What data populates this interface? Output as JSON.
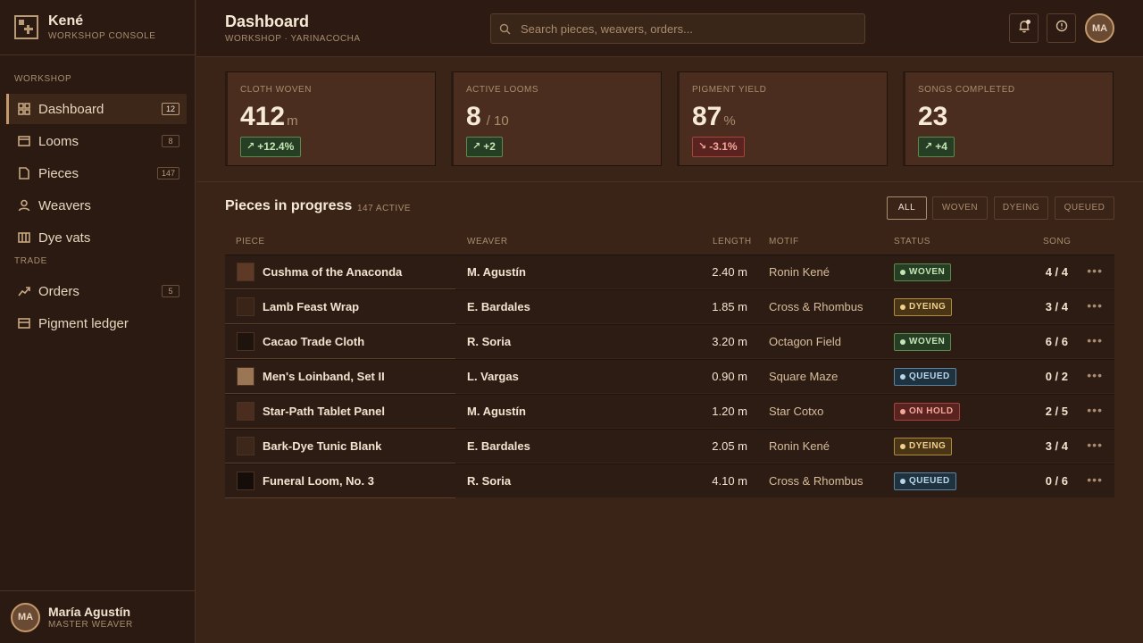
{
  "brand": {
    "title": "Kené",
    "subtitle": "WORKSHOP CONSOLE"
  },
  "sidebar": {
    "sections": [
      {
        "label": "WORKSHOP"
      },
      {
        "label": "TRADE"
      }
    ],
    "items": [
      {
        "label": "Dashboard",
        "count": "12",
        "icon": "grid-icon",
        "active": true
      },
      {
        "label": "Looms",
        "count": "8",
        "icon": "loom-icon"
      },
      {
        "label": "Pieces",
        "count": "147",
        "icon": "document-icon"
      },
      {
        "label": "Weavers",
        "count": "",
        "icon": "person-icon"
      },
      {
        "label": "Dye vats",
        "count": "",
        "icon": "vat-icon"
      },
      {
        "label": "Orders",
        "count": "5",
        "icon": "trend-icon"
      },
      {
        "label": "Pigment ledger",
        "count": "",
        "icon": "ledger-icon"
      }
    ]
  },
  "user": {
    "initials": "MA",
    "name": "María Agustín",
    "role": "MASTER WEAVER"
  },
  "header": {
    "title": "Dashboard",
    "subtitle": "WORKSHOP · YARINACOCHA",
    "search_placeholder": "Search pieces, weavers, orders...",
    "avatar_initials": "MA"
  },
  "stats": [
    {
      "label": "CLOTH WOVEN",
      "value": "412",
      "unit": "m",
      "delta": "+12.4%",
      "direction": "up"
    },
    {
      "label": "ACTIVE LOOMS",
      "value": "8",
      "unit": "/ 10",
      "delta": "+2",
      "direction": "up"
    },
    {
      "label": "PIGMENT YIELD",
      "value": "87",
      "unit": "%",
      "delta": "-3.1%",
      "direction": "down"
    },
    {
      "label": "SONGS COMPLETED",
      "value": "23",
      "unit": "",
      "delta": "+4",
      "direction": "up"
    }
  ],
  "table": {
    "title": "Pieces in progress",
    "count": "147 ACTIVE",
    "filters": [
      "ALL",
      "WOVEN",
      "DYEING",
      "QUEUED"
    ],
    "active_filter": "ALL",
    "columns": {
      "piece": "PIECE",
      "weaver": "WEAVER",
      "length": "LENGTH",
      "motif": "MOTIF",
      "status": "STATUS",
      "song": "SONG"
    },
    "rows": [
      {
        "piece": "Cushma of the Anaconda",
        "swatch": "#5e3a26",
        "weaver": "M. Agustín",
        "length": "2.40 m",
        "motif": "Ronin Kené",
        "status": "WOVEN",
        "song": "4 / 4"
      },
      {
        "piece": "Lamb Feast Wrap",
        "swatch": "#3a2418",
        "weaver": "E. Bardales",
        "length": "1.85 m",
        "motif": "Cross & Rhombus",
        "status": "DYEING",
        "song": "3 / 4"
      },
      {
        "piece": "Cacao Trade Cloth",
        "swatch": "#1f130d",
        "weaver": "R. Soria",
        "length": "3.20 m",
        "motif": "Octagon Field",
        "status": "WOVEN",
        "song": "6 / 6"
      },
      {
        "piece": "Men's Loinband, Set II",
        "swatch": "#9a7654",
        "weaver": "L. Vargas",
        "length": "0.90 m",
        "motif": "Square Maze",
        "status": "QUEUED",
        "song": "0 / 2"
      },
      {
        "piece": "Star-Path Tablet Panel",
        "swatch": "#4a2d1f",
        "weaver": "M. Agustín",
        "length": "1.20 m",
        "motif": "Star Cotxo",
        "status": "ON HOLD",
        "song": "2 / 5"
      },
      {
        "piece": "Bark-Dye Tunic Blank",
        "swatch": "#3d271b",
        "weaver": "E. Bardales",
        "length": "2.05 m",
        "motif": "Ronin Kené",
        "status": "DYEING",
        "song": "3 / 4"
      },
      {
        "piece": "Funeral Loom, No. 3",
        "swatch": "#150d09",
        "weaver": "R. Soria",
        "length": "4.10 m",
        "motif": "Cross & Rhombus",
        "status": "QUEUED",
        "song": "0 / 6"
      }
    ]
  }
}
